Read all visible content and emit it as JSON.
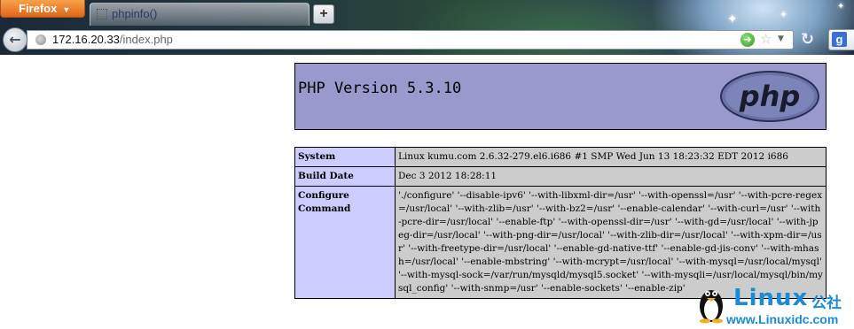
{
  "browser": {
    "menu_button": "Firefox",
    "tab_title": "phpinfo()",
    "new_tab_label": "+",
    "url_host": "172.16.20.33",
    "url_path": "/index.php",
    "search_engine_icon": "google-icon"
  },
  "page": {
    "header_title": "PHP Version 5.3.10",
    "logo_text": "php",
    "rows": [
      {
        "label": "System",
        "value": "Linux kumu.com 2.6.32-279.el6.i686 #1 SMP Wed Jun 13 18:23:32 EDT 2012 i686"
      },
      {
        "label": "Build Date",
        "value": "Dec 3 2012 18:28:11"
      },
      {
        "label": "Configure Command",
        "value": "'./configure' '--disable-ipv6' '--with-libxml-dir=/usr' '--with-openssl=/usr' '--with-pcre-regex=/usr/local' '--with-zlib=/usr' '--with-bz2=/usr' '--enable-calendar' '--with-curl=/usr' '--with-pcre-dir=/usr/local' '--enable-ftp' '--with-openssl-dir=/usr' '--with-gd=/usr/local' '--with-jpeg-dir=/usr/local' '--with-png-dir=/usr/local' '--with-zlib-dir=/usr/local' '--with-xpm-dir=/usr' '--with-freetype-dir=/usr/local' '--enable-gd-native-ttf' '--enable-gd-jis-conv' '--with-mhash=/usr/local' '--enable-mbstring' '--with-mcrypt=/usr/local' '--with-mysql=/usr/local/mysql' '--with-mysql-sock=/var/run/mysqld/mysql5.socket' '--with-mysqli=/usr/local/mysql/bin/mysql_config' '--with-snmp=/usr' '--enable-sockets' '--enable-zip'"
      }
    ]
  },
  "watermark": {
    "brand": "Linux",
    "brand_cn": "公社",
    "site": "www.Linuxidc.com"
  },
  "colors": {
    "header_bg": "#9999cc",
    "label_bg": "#ccccff",
    "value_bg": "#cccccc",
    "firefox_orange": "#e0651a",
    "watermark_blue": "#1a8bd6"
  }
}
